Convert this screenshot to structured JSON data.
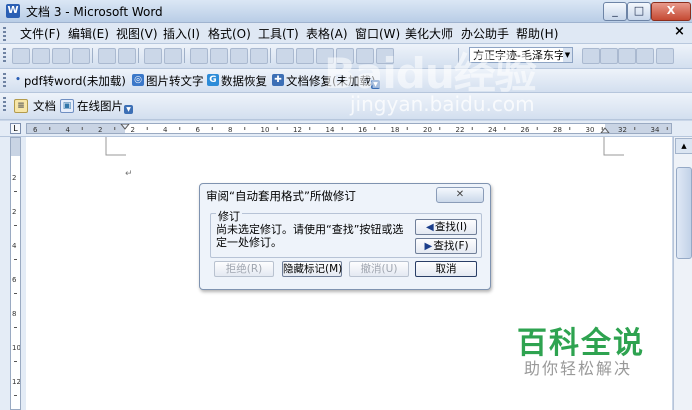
{
  "window": {
    "title": "文档 3 - Microsoft Word",
    "min_label": "_",
    "max_label": "□",
    "close_label": "X"
  },
  "menu": {
    "items": [
      "文件(F)",
      "编辑(E)",
      "视图(V)",
      "插入(I)",
      "格式(O)",
      "工具(T)",
      "表格(A)",
      "窗口(W)",
      "美化大师",
      "办公助手",
      "帮助(H)"
    ],
    "close_label": "×"
  },
  "toolbar_format": {
    "font_name": "方正字迹-毛泽东字体"
  },
  "toolbar_addins": {
    "items": [
      "pdf转word(未加载)",
      "图片转文字",
      "数据恢复",
      "文档修复(未加载)"
    ]
  },
  "toolbar_tabs": {
    "items": [
      "文档",
      "在线图片"
    ]
  },
  "ruler": {
    "ticks": [
      "6",
      "4",
      "2",
      "2",
      "4",
      "6",
      "8",
      "10",
      "12",
      "14",
      "16",
      "18",
      "20",
      "22",
      "24",
      "26",
      "28",
      "30",
      "32",
      "34"
    ]
  },
  "vruler": {
    "ticks": [
      "2",
      "2",
      "4",
      "6",
      "8",
      "10",
      "12",
      "14"
    ]
  },
  "dialog": {
    "title": "审阅“自动套用格式”所做修订",
    "close_label": "✕",
    "group_label": "修订",
    "message_line1": "尚未选定修订。请使用“查找”按钮或选",
    "message_line2": "定一处修订。",
    "find_prev_label": "查找(I)",
    "find_next_label": "查找(F)",
    "reject_label": "拒绝(R)",
    "hide_marks_label": "隐藏标记(M)",
    "undo_label": "撤消(U)",
    "cancel_label": "取消"
  },
  "watermarks": {
    "baidu": "Baidu经验",
    "jingyan": "jingyan.baidu.com",
    "baike": "百科全说",
    "help": "助你轻松解决"
  },
  "colors": {
    "accent_green": "#2ea350",
    "title_bar": "#c9d9ee"
  }
}
